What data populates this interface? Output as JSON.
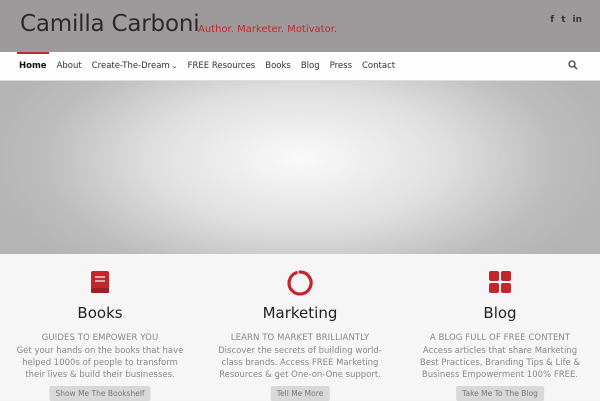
{
  "header": {
    "site_title": "Camilla Carboni",
    "tagline": "Author. Marketer. Motivator.",
    "social": [
      {
        "icon": "facebook-icon",
        "glyph": "f"
      },
      {
        "icon": "twitter-icon",
        "glyph": "t"
      },
      {
        "icon": "linkedin-icon",
        "glyph": "in"
      }
    ]
  },
  "nav": {
    "items": [
      {
        "label": "Home",
        "active": true
      },
      {
        "label": "About"
      },
      {
        "label": "Create-The-Dream",
        "has_dropdown": true,
        "caret": "⌄"
      },
      {
        "label": "FREE Resources"
      },
      {
        "label": "Books"
      },
      {
        "label": "Blog"
      },
      {
        "label": "Press"
      },
      {
        "label": "Contact"
      }
    ],
    "search_icon": "search-icon"
  },
  "colors": {
    "accent": "#c0282d",
    "header_bg": "#9e9a9b"
  },
  "features": [
    {
      "icon": "book-icon",
      "title": "Books",
      "subtitle": "GUIDES TO EMPOWER YOU",
      "description": "Get your hands on the books that have helped 1000s of people to transform their lives & build their businesses.",
      "button": "Show Me The Bookshelf"
    },
    {
      "icon": "power-circle-icon",
      "title": "Marketing",
      "subtitle": "LEARN TO MARKET BRILLIANTLY",
      "description": "Discover the secrets of building world-class brands. Access FREE Marketing Resources & get One-on-One support.",
      "button": "Tell Me More"
    },
    {
      "icon": "grid-icon",
      "title": "Blog",
      "subtitle": "A BLOG FULL OF FREE CONTENT",
      "description": "Access articles that share Marketing Best Practices, Branding Tips & Life & Business Empowerment 100% FREE.",
      "button": "Take Me To The Blog"
    }
  ]
}
